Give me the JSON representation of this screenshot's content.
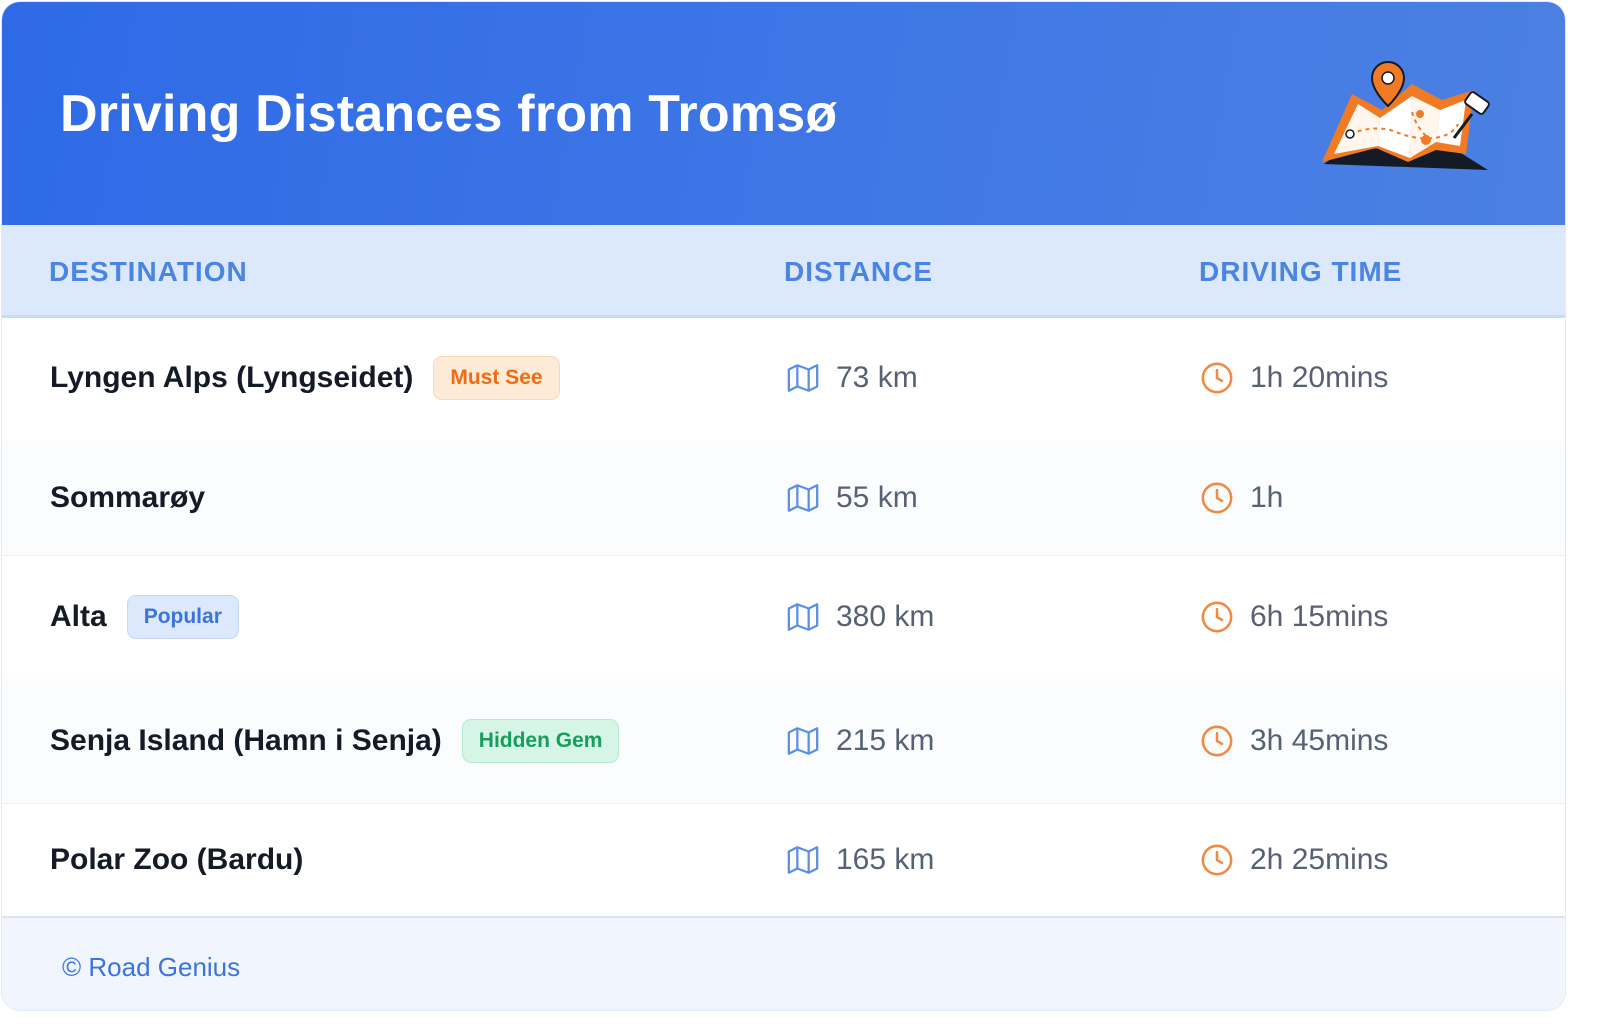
{
  "header": {
    "title": "Driving Distances from Tromsø",
    "icon": "folded-map-pin-icon"
  },
  "table": {
    "columns": [
      "DESTINATION",
      "DISTANCE",
      "DRIVING TIME"
    ],
    "rows": [
      {
        "destination": "Lyngen Alps (Lyngseidet)",
        "badge": "Must See",
        "distance": "73 km",
        "time": "1h 20mins"
      },
      {
        "destination": "Sommarøy",
        "badge": "",
        "distance": "55 km",
        "time": "1h"
      },
      {
        "destination": "Alta",
        "badge": "Popular",
        "distance": "380 km",
        "time": "6h 15mins"
      },
      {
        "destination": "Senja Island (Hamn i Senja)",
        "badge": "Hidden Gem",
        "distance": "215 km",
        "time": "3h 45mins"
      },
      {
        "destination": "Polar Zoo (Bardu)",
        "badge": "",
        "distance": "165 km",
        "time": "2h 25mins"
      }
    ]
  },
  "badges": {
    "Must See": {
      "bg": "#fdebd7",
      "fg": "#ef6c12",
      "border": "#f9d8b5"
    },
    "Popular": {
      "bg": "#dce9fd",
      "fg": "#3b74dc",
      "border": "#c2d7f8"
    },
    "Hidden Gem": {
      "bg": "#d6f5e6",
      "fg": "#14a05c",
      "border": "#b5ebd1"
    }
  },
  "icons": {
    "distance": "map-icon",
    "time": "clock-icon"
  },
  "colors": {
    "header_bg": "#3470e6",
    "accent": "#4b84e1",
    "map_icon": "#5c8fe4",
    "clock_icon": "#ef8a43"
  },
  "footer": {
    "text": "© Road Genius"
  }
}
